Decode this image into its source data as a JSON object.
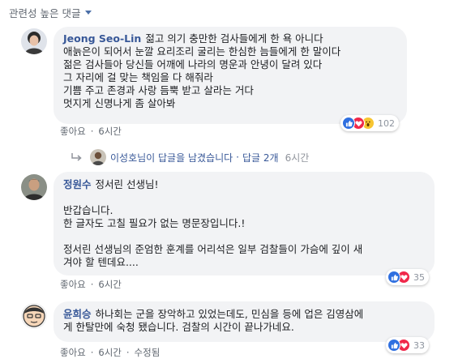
{
  "sort": {
    "label": "관련성 높은 댓글"
  },
  "comments": [
    {
      "author": "Jeong Seo-Lin",
      "lines": [
        "젊고 의기 충만한 검사들에게 한 욕 아니다",
        "애늙은이 되어서 눈깔 요리조리 굴리는 한심한 늠들에게 한 말이다",
        "젊은 검사들아 당신들 어깨에 나라의 명운과 안녕이 달려 있다",
        "그 자리에 걸 맞는 책임을 다 해줘라",
        "기쁨 주고 존경과 사랑 듬뿍 받고 살라는 거다",
        "멋지게 신명나게 좀 살아봐"
      ],
      "like_label": "좋아요",
      "time": "6시간",
      "reactions": [
        "like-icon",
        "love-icon",
        "wow-icon"
      ],
      "reaction_count": "102"
    },
    {
      "author": "정원수",
      "first_line": "정서린 선생님!",
      "para1": [
        "반갑습니다.",
        "한 글자도 고칠 필요가 없는 명문장입니다.!"
      ],
      "para2": [
        "정서린 선생님의 준엄한 훈계를 어리석은 일부 검찰들이 가슴에 깊이 새",
        "겨야 할 텐데요...."
      ],
      "like_label": "좋아요",
      "time": "6시간",
      "reactions": [
        "like-icon",
        "love-icon"
      ],
      "reaction_count": "35"
    },
    {
      "author": "윤희승",
      "first_line": "하나회는 군을 장악하고 있었는데도, 민심을 등에 업은 김영삼에",
      "lines": [
        "게 한탈만에 숙청 됐습니다. 검찰의 시간이 끝나가네요."
      ],
      "like_label": "좋아요",
      "time": "6시간",
      "edited_label": "수정됨",
      "reactions": [
        "like-icon",
        "love-icon"
      ],
      "reaction_count": "33"
    }
  ],
  "replies": {
    "text": "이성호님이 답글을 남겼습니다",
    "count_label": "답글 2개",
    "time": "6시간"
  }
}
